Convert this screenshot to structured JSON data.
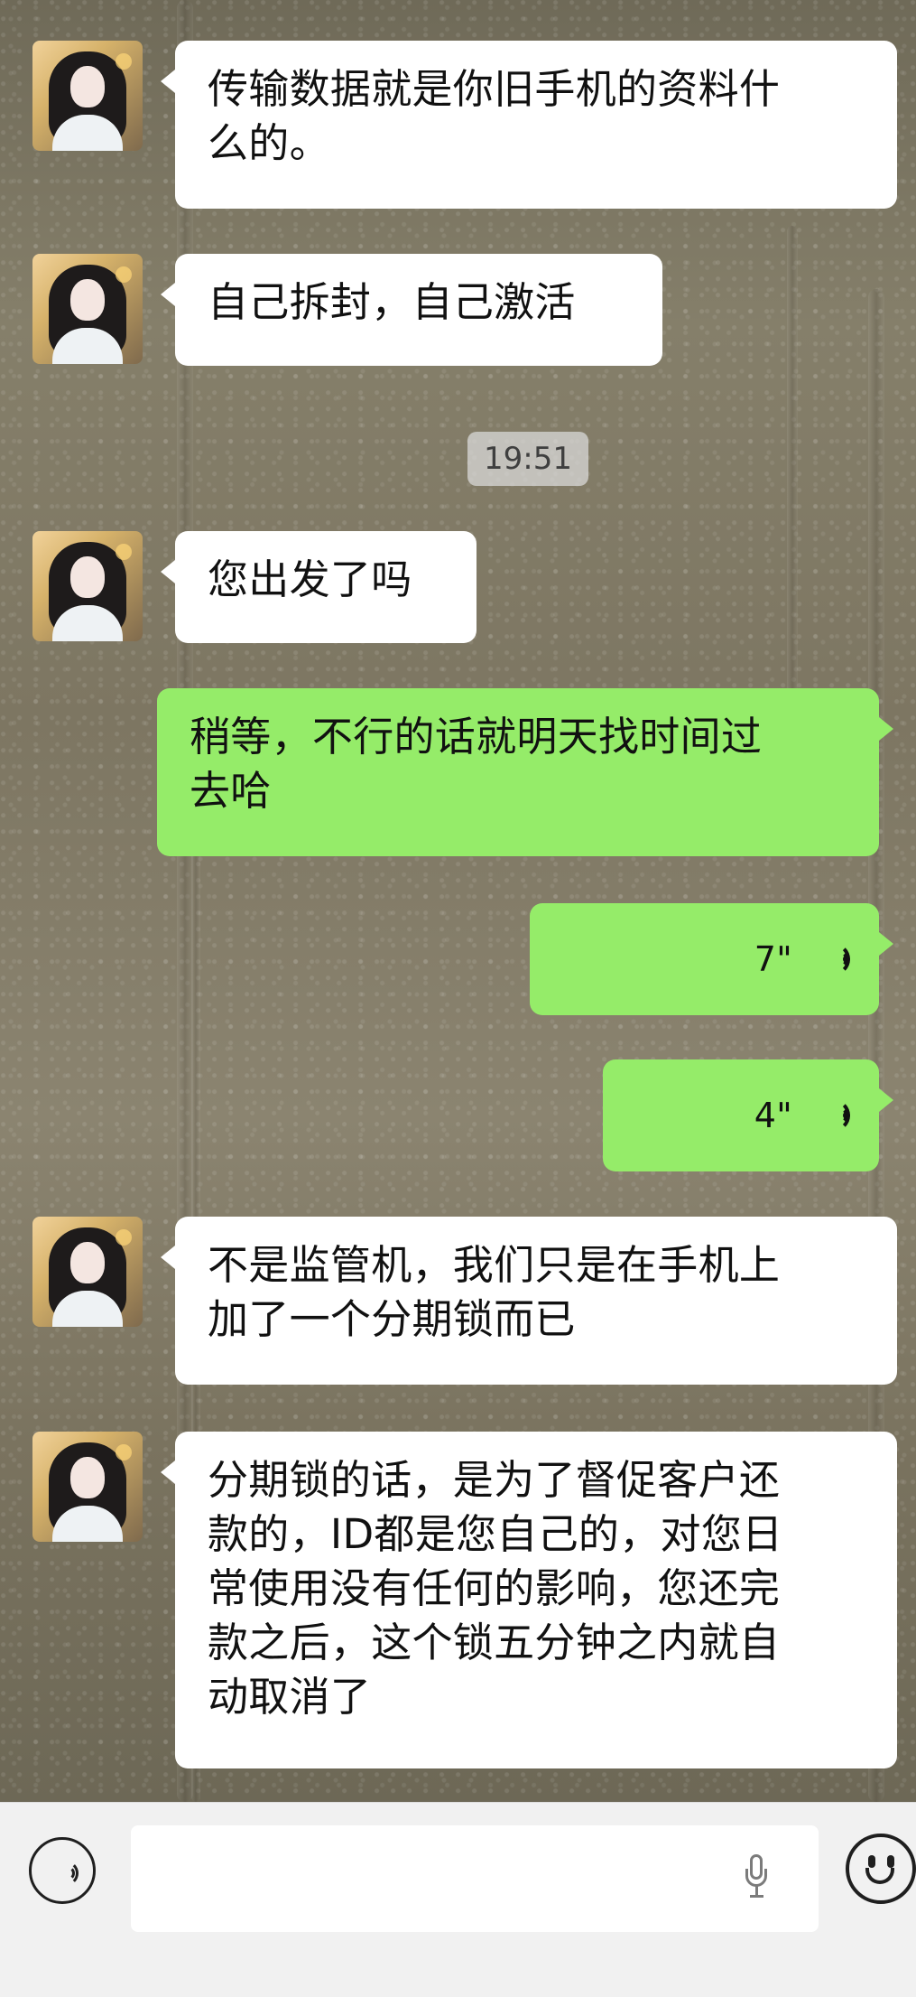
{
  "conversation": {
    "timestamp": "19:51",
    "messages": [
      {
        "text": "传输数据就是你旧手机的资料什\n么的。"
      },
      {
        "text": "自己拆封，自己激活"
      },
      {
        "text": "您出发了吗"
      },
      {
        "text": "稍等，不行的话就明天找时间过\n去哈"
      },
      {
        "voice_duration": "7\""
      },
      {
        "voice_duration": "4\""
      },
      {
        "text": "不是监管机，我们只是在手机上\n加了一个分期锁而已"
      },
      {
        "text": "分期锁的话，是为了督促客户还\n款的，ID都是您自己的，对您日\n常使用没有任何的影响，您还完\n款之后，这个锁五分钟之内就自\n动取消了"
      }
    ]
  },
  "composer": {
    "input_value": "",
    "icons": {
      "voice_toggle": "voice-toggle-icon",
      "mic": "mic-icon",
      "emoji": "emoji-icon"
    }
  },
  "colors": {
    "incoming_bubble": "#ffffff",
    "outgoing_bubble": "#95ec69",
    "composer_bg": "#f1f1f1",
    "timestamp_bg": "#dcdcdc"
  }
}
